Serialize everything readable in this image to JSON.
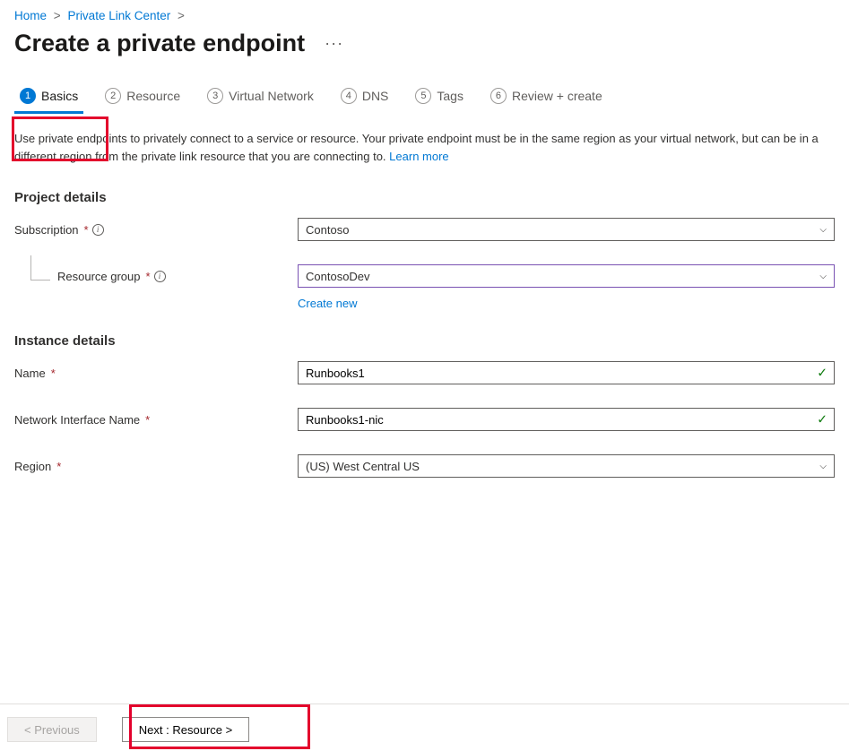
{
  "breadcrumb": {
    "home": "Home",
    "plc": "Private Link Center"
  },
  "title": "Create a private endpoint",
  "tabs": [
    {
      "num": "1",
      "label": "Basics"
    },
    {
      "num": "2",
      "label": "Resource"
    },
    {
      "num": "3",
      "label": "Virtual Network"
    },
    {
      "num": "4",
      "label": "DNS"
    },
    {
      "num": "5",
      "label": "Tags"
    },
    {
      "num": "6",
      "label": "Review + create"
    }
  ],
  "desc": {
    "text": "Use private endpoints to privately connect to a service or resource. Your private endpoint must be in the same region as your virtual network, but can be in a different region from the private link resource that you are connecting to.  ",
    "link": "Learn more"
  },
  "sections": {
    "project": "Project details",
    "instance": "Instance details"
  },
  "fields": {
    "subscription": {
      "label": "Subscription",
      "value": "Contoso"
    },
    "resource_group": {
      "label": "Resource group",
      "value": "ContosoDev",
      "create_new": "Create new"
    },
    "name": {
      "label": "Name",
      "value": "Runbooks1"
    },
    "nic": {
      "label": "Network Interface Name",
      "value": "Runbooks1-nic"
    },
    "region": {
      "label": "Region",
      "value": "(US) West Central US"
    }
  },
  "footer": {
    "prev": "< Previous",
    "next": "Next : Resource >"
  },
  "icons": {
    "info": "i",
    "check": "✓",
    "chev": "⌵",
    "dots": "···"
  }
}
